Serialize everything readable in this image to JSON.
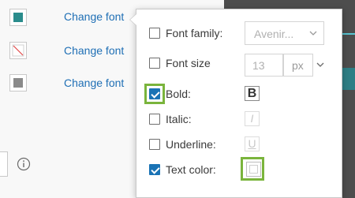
{
  "left_panel": {
    "rows": [
      {
        "link": "Change font",
        "swatch": "teal-fill-icon",
        "swatch_color": "#2a8c8c"
      },
      {
        "link": "Change font",
        "swatch": "no-color-icon",
        "swatch_color": "#e04848"
      },
      {
        "link": "Change font",
        "swatch": "gray-fill-icon",
        "swatch_color": "#8a8a8a"
      }
    ],
    "info_icon": "info-icon"
  },
  "popover": {
    "font_family": {
      "label": "Font family:",
      "checked": false,
      "value": "Avenir..."
    },
    "font_size": {
      "label": "Font size",
      "checked": false,
      "value": "13",
      "unit": "px"
    },
    "bold": {
      "label": "Bold:",
      "checked": true,
      "button": "B"
    },
    "italic": {
      "label": "Italic:",
      "checked": false,
      "button": "I"
    },
    "underline": {
      "label": "Underline:",
      "checked": false,
      "button": "U"
    },
    "text_color": {
      "label": "Text color:",
      "checked": true
    }
  },
  "colors": {
    "accent": "#1a73b5",
    "highlight": "#7ab43c",
    "link": "#1f6fb5",
    "dark_panel": "#4d4d4d"
  }
}
